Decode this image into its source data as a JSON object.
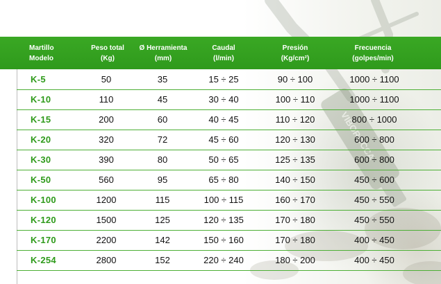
{
  "header": {
    "col_model": [
      "Martillo",
      "Modelo"
    ],
    "col_weight": [
      "Peso total",
      "(Kg)"
    ],
    "col_tool": [
      "Ø Herramienta",
      "(mm)"
    ],
    "col_flow": [
      "Caudal",
      "(l/min)"
    ],
    "col_pressure": [
      "Presión",
      "(Kg/cm²)"
    ],
    "col_freq": [
      "Frecuencia",
      "(golpes/min)"
    ]
  },
  "rows": [
    {
      "model": "K-5",
      "weight": "50",
      "tool": "35",
      "flow": "15 ÷ 25",
      "pressure": "90 ÷ 100",
      "freq": "1000 ÷ 1100"
    },
    {
      "model": "K-10",
      "weight": "110",
      "tool": "45",
      "flow": "30 ÷ 40",
      "pressure": "100 ÷ 110",
      "freq": "1000 ÷ 1100"
    },
    {
      "model": "K-15",
      "weight": "200",
      "tool": "60",
      "flow": "40 ÷ 45",
      "pressure": "110 ÷ 120",
      "freq": "800 ÷ 1000"
    },
    {
      "model": "K-20",
      "weight": "320",
      "tool": "72",
      "flow": "45 ÷ 60",
      "pressure": "120 ÷ 130",
      "freq": "600 ÷ 800"
    },
    {
      "model": "K-30",
      "weight": "390",
      "tool": "80",
      "flow": "50 ÷ 65",
      "pressure": "125 ÷ 135",
      "freq": "600 ÷ 800"
    },
    {
      "model": "K-50",
      "weight": "560",
      "tool": "95",
      "flow": "65 ÷ 80",
      "pressure": "140 ÷ 150",
      "freq": "450 ÷ 600"
    },
    {
      "model": "K-100",
      "weight": "1200",
      "tool": "115",
      "flow": "100 ÷ 115",
      "pressure": "160 ÷ 170",
      "freq": "450 ÷ 550"
    },
    {
      "model": "K-120",
      "weight": "1500",
      "tool": "125",
      "flow": "120 ÷ 135",
      "pressure": "170 ÷ 180",
      "freq": "450 ÷ 550"
    },
    {
      "model": "K-170",
      "weight": "2200",
      "tool": "142",
      "flow": "150 ÷ 160",
      "pressure": "170 ÷ 180",
      "freq": "400 ÷ 450"
    },
    {
      "model": "K-254",
      "weight": "2800",
      "tool": "152",
      "flow": "220 ÷ 240",
      "pressure": "180 ÷ 200",
      "freq": "400 ÷ 450"
    }
  ],
  "backdrop": {
    "brand_text": "VIBOROCCA"
  },
  "colors": {
    "header_green": "#34a11f",
    "model_green": "#2e9a1a",
    "row_line": "#4caf34"
  }
}
